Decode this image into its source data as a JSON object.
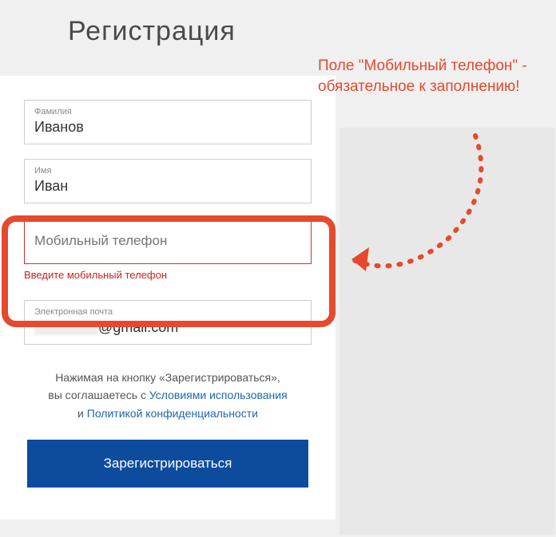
{
  "title": "Регистрация",
  "annotation": "Поле \"Мобильный телефон\" - обязательное к заполнению!",
  "fields": {
    "surname": {
      "label": "Фамилия",
      "value": "Иванов"
    },
    "name": {
      "label": "Имя",
      "value": "Иван"
    },
    "phone": {
      "placeholder": "Мобильный телефон",
      "error": "Введите мобильный телефон"
    },
    "email": {
      "label": "Электронная почта",
      "suffix": "@gmail.com"
    }
  },
  "consent": {
    "line1_prefix": "Нажимая на кнопку «Зарегистрироваться»,",
    "line2_prefix": "вы соглашаетесь с ",
    "terms_link": "Условиями использования",
    "line3_prefix": "и ",
    "privacy_link": "Политикой конфиденциальности"
  },
  "register_button": "Зарегистрироваться"
}
